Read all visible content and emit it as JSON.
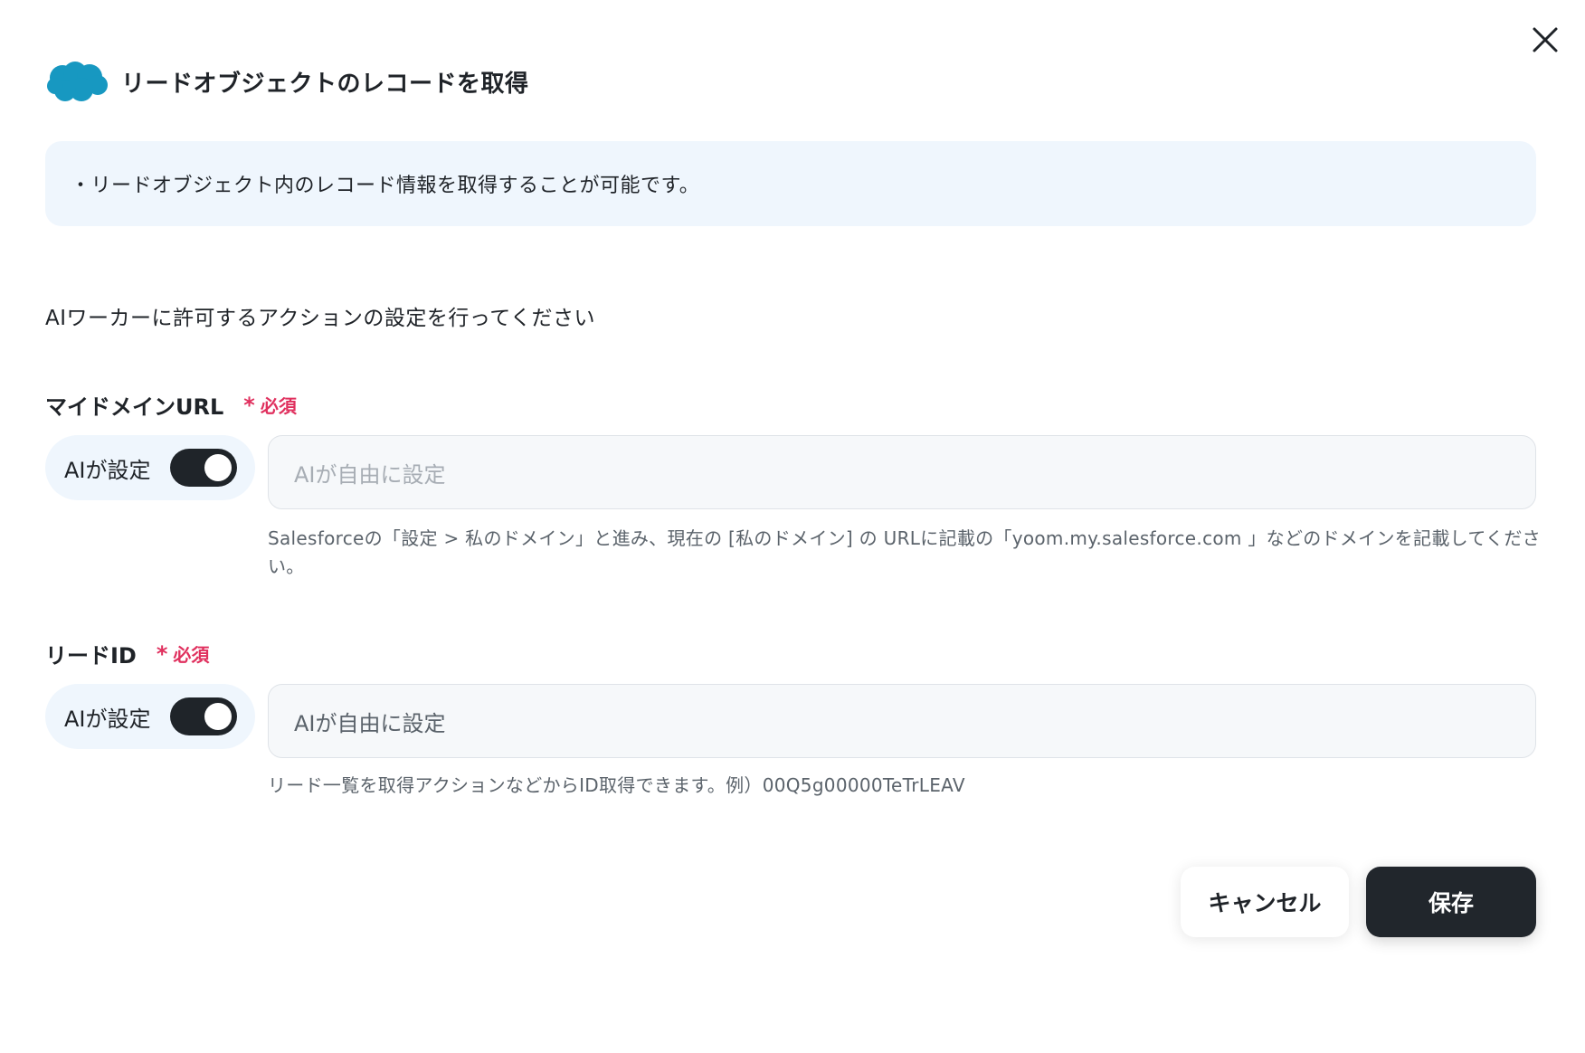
{
  "dialog": {
    "title": "リードオブジェクトのレコードを取得",
    "logo_icon": "salesforce-cloud-icon",
    "close_icon": "close-icon",
    "info_text": "・リードオブジェクト内のレコード情報を取得することが可能です。",
    "instruction": "AIワーカーに許可するアクションの設定を行ってください"
  },
  "fields": [
    {
      "label": "マイドメインURL",
      "required_mark": "*",
      "required_text": "必須",
      "ai_toggle_label": "AIが設定",
      "ai_toggle_on": true,
      "placeholder": "AIが自由に設定",
      "help": "Salesforceの「設定 > 私のドメイン」と進み、現在の [私のドメイン] の URLに記載の「yoom.my.salesforce.com 」などのドメインを記載してください。"
    },
    {
      "label": "リードID",
      "required_mark": "*",
      "required_text": "必須",
      "ai_toggle_label": "AIが設定",
      "ai_toggle_on": true,
      "placeholder": "AIが自由に設定",
      "help": "リード一覧を取得アクションなどからID取得できます。例）00Q5g00000TeTrLEAV"
    }
  ],
  "buttons": {
    "cancel": "キャンセル",
    "save": "保存"
  },
  "colors": {
    "accent_required": "#e0305e",
    "info_bg": "#eff6fd",
    "toggle_on": "#1f2429",
    "save_bg": "#21262c",
    "salesforce_blue": "#1798c1"
  }
}
